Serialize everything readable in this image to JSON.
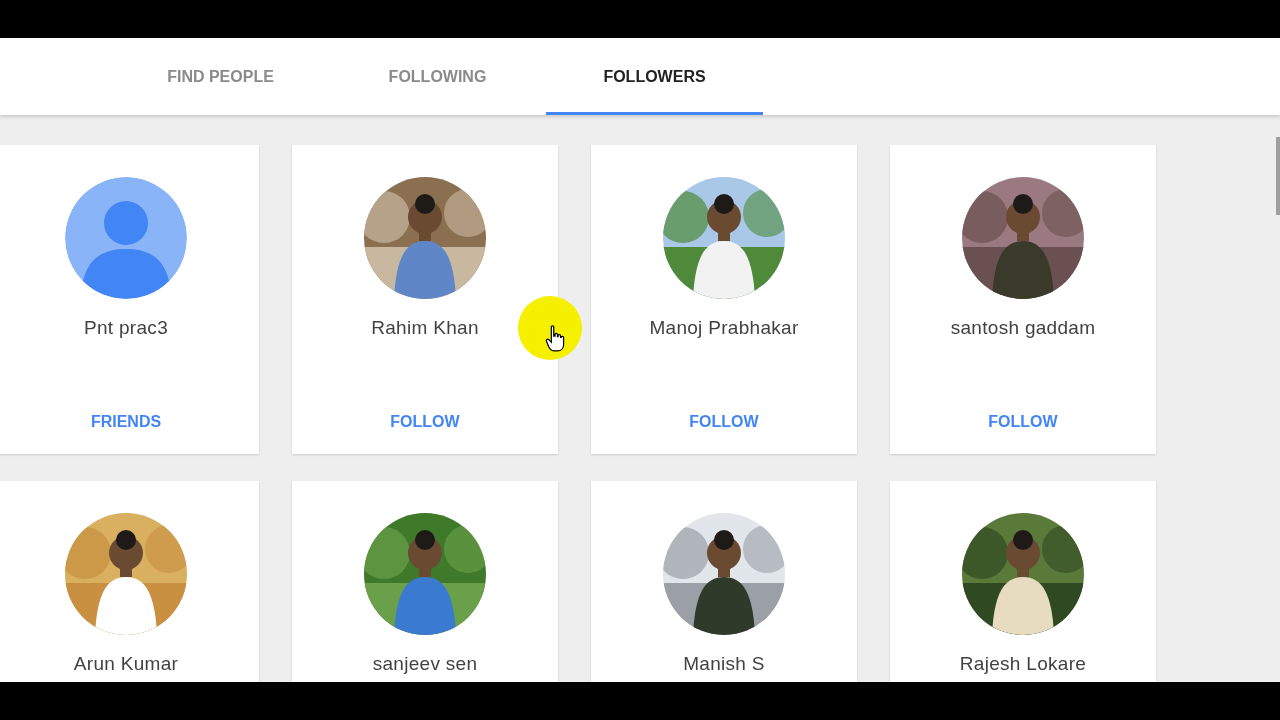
{
  "tabs": [
    {
      "label": "FIND PEOPLE",
      "selected": false
    },
    {
      "label": "FOLLOWING",
      "selected": false
    },
    {
      "label": "FOLLOWERS",
      "selected": true
    }
  ],
  "people": [
    {
      "name": "Pnt prac3",
      "action": "FRIENDS",
      "kind": "default"
    },
    {
      "name": "Rahim Khan",
      "action": "FOLLOW",
      "kind": "picture"
    },
    {
      "name": "Manoj Prabhakar",
      "action": "FOLLOW",
      "kind": "picture"
    },
    {
      "name": "santosh gaddam",
      "action": "FOLLOW",
      "kind": "picture"
    },
    {
      "name": "Arun Kumar",
      "kind": "picture"
    },
    {
      "name": "sanjeev sen",
      "kind": "picture"
    },
    {
      "name": "Manish S",
      "kind": "picture"
    },
    {
      "name": "Rajesh Lokare",
      "kind": "picture"
    }
  ]
}
